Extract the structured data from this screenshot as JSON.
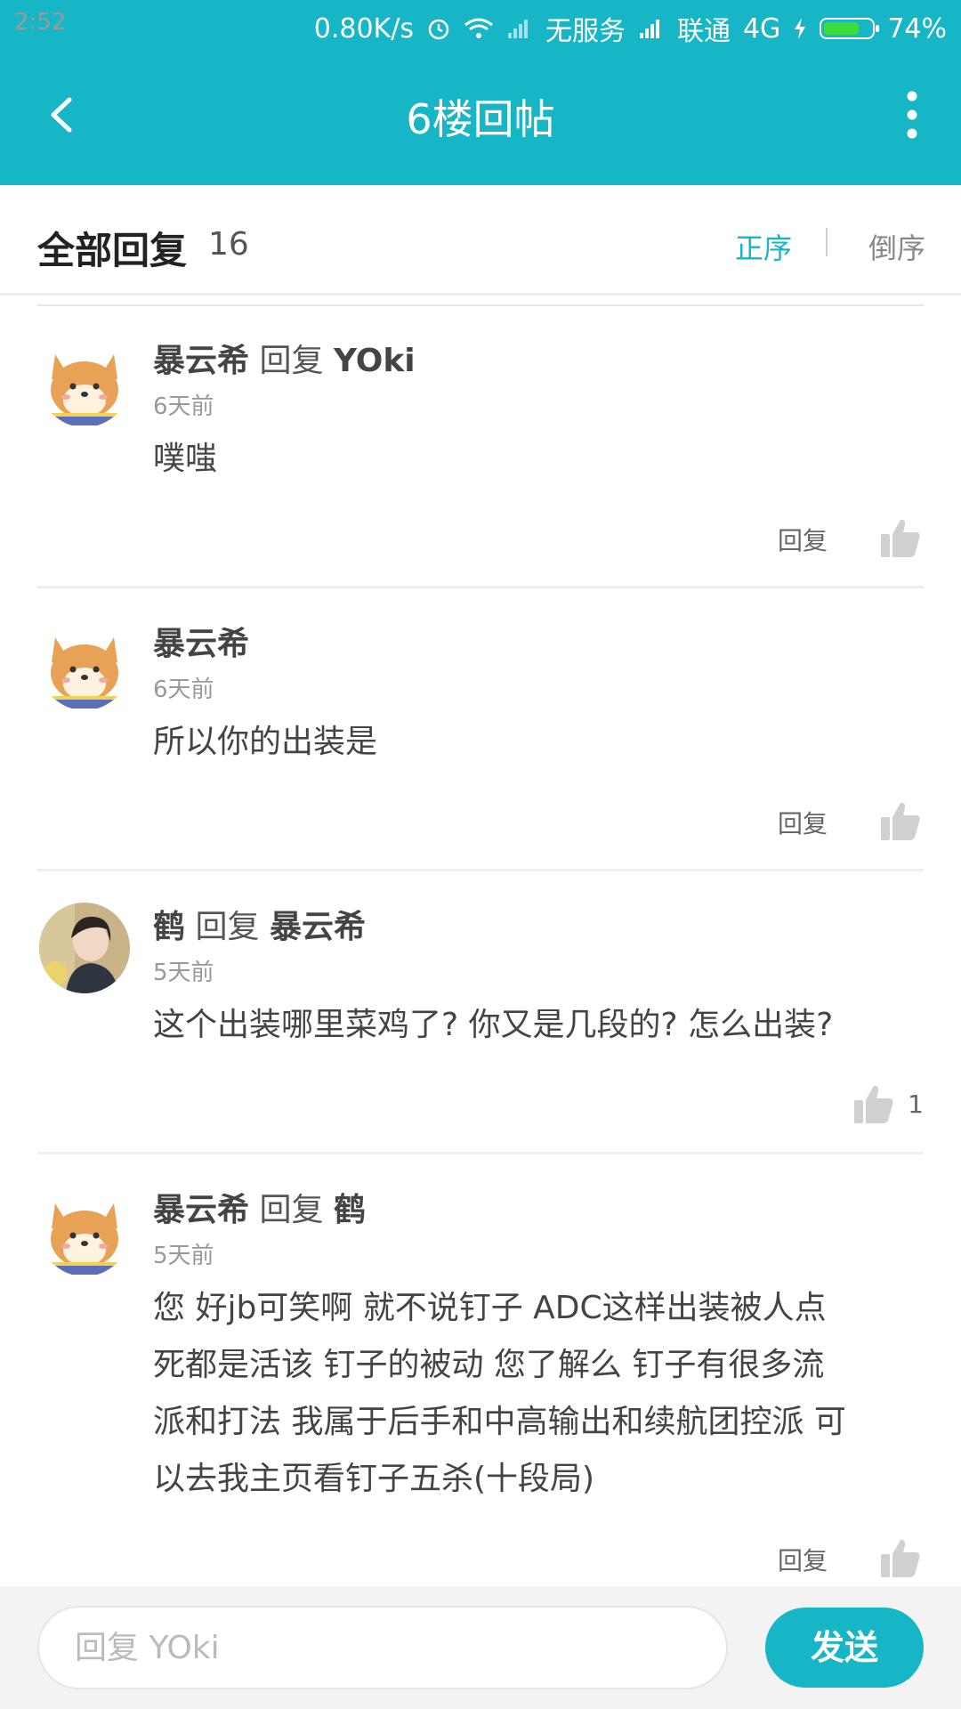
{
  "status_bar": {
    "time": "2:52",
    "net_speed": "0.80K/s",
    "no_service": "无服务",
    "carrier": "联通",
    "network": "4G",
    "battery": "74%",
    "battery_level": 0.74
  },
  "nav": {
    "title": "6楼回帖"
  },
  "header": {
    "title": "全部回复",
    "count": "16",
    "sort_asc": "正序",
    "sort_desc": "倒序"
  },
  "replies": [
    {
      "author": "暴云希",
      "reply_word": "回复",
      "reply_to": "YOki",
      "time": "6天前",
      "lines": [
        "噗嗤"
      ],
      "reply_label": "回复",
      "likes": "",
      "avatar": "shiba-avatar"
    },
    {
      "author": "暴云希",
      "reply_word": "",
      "reply_to": "",
      "time": "6天前",
      "lines": [
        "所以你的出装是"
      ],
      "reply_label": "回复",
      "likes": "",
      "avatar": "shiba-avatar"
    },
    {
      "author": "鹤",
      "reply_word": "回复",
      "reply_to": "暴云希",
      "time": "5天前",
      "lines": [
        "这个出装哪里菜鸡了? 你又是几段的? 怎么出装?"
      ],
      "reply_label": "",
      "likes": "1",
      "avatar": "person-avatar"
    },
    {
      "author": "暴云希",
      "reply_word": "回复",
      "reply_to": "鹤",
      "time": "5天前",
      "lines": [
        "您  好jb可笑啊  就不说钉子  ADC这样出装被人点",
        "死都是活该  钉子的被动 您了解么  钉子有很多流",
        "派和打法  我属于后手和中高输出和续航团控派  可",
        "以去我主页看钉子五杀(十段局)"
      ],
      "reply_label": "回复",
      "likes": "",
      "avatar": "shiba-avatar"
    }
  ],
  "bottom": {
    "placeholder": "回复 YOki",
    "send": "发送"
  },
  "colors": {
    "accent": "#17b6c6",
    "battery": "#3ddc3d"
  }
}
